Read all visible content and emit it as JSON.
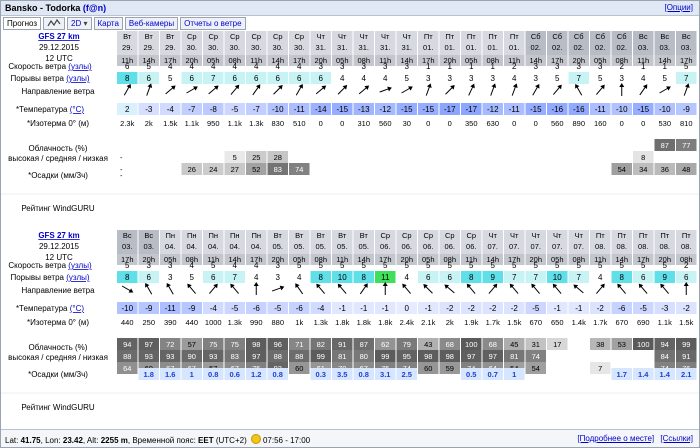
{
  "title": "Bansko - Todorka",
  "title_fan": "(f@n)",
  "options_link": "[Опции]",
  "tabs": [
    {
      "label": "Прогноз",
      "active": true
    },
    {
      "label": "~",
      "icon": "chart-wave-icon"
    },
    {
      "label": "2D"
    },
    {
      "label": "Карта"
    },
    {
      "label": "Веб-камеры"
    },
    {
      "label": "Отчеты о ветре"
    }
  ],
  "row_labels": {
    "wind": "Скорость ветра",
    "wind_unit": "(узлы)",
    "gust": "Порывы ветра",
    "gust_unit": "(узлы)",
    "dir": "Направление ветра",
    "temp": "*Температура",
    "temp_unit": "(°C)",
    "iso": "*Изотерма 0° (м)",
    "cloud1": "Облачность (%)",
    "cloud2": "высокая / средняя / низкая",
    "precip": "*Осадки (мм/3ч)",
    "rating": "Рейтинг WindGURU"
  },
  "colors": {
    "header_bg": "#d6d9df",
    "weekend_bg": "#b8bcc5",
    "wind_light": "#ffffff",
    "gust_lo": "#ffffff",
    "gust_mid": "#c7f3f5",
    "gust_hi": "#5fe0e8",
    "gust_top": "#3ee05a",
    "temp_pos": "#d9f0ff",
    "temp_neg": "#a9b6ff",
    "cloud_low": "#e6e6e6",
    "cloud_mid": "#a6a6a6",
    "cloud_hi": "#808080",
    "precip_bg": "#d6e6ff",
    "precip_text": "#1f3fd1"
  },
  "blocks": [
    {
      "model": "GFS 27 km",
      "date": "29.12.2015",
      "utc": "12 UTC",
      "days": [
        "Вт",
        "Вт",
        "Вт",
        "Ср",
        "Ср",
        "Ср",
        "Ср",
        "Ср",
        "Ср",
        "Чт",
        "Чт",
        "Чт",
        "Чт",
        "Чт",
        "Пт",
        "Пт",
        "Пт",
        "Пт",
        "Пт",
        "Сб",
        "Сб",
        "Сб",
        "Сб",
        "Сб",
        "Вс",
        "Вс",
        "Вс"
      ],
      "dates": [
        "29.",
        "29.",
        "29.",
        "30.",
        "30.",
        "30.",
        "30.",
        "30.",
        "30.",
        "31.",
        "31.",
        "31.",
        "31.",
        "31.",
        "01.",
        "01.",
        "01.",
        "01.",
        "01.",
        "02.",
        "02.",
        "02.",
        "02.",
        "02.",
        "03.",
        "03.",
        "03."
      ],
      "hours": [
        "11h",
        "14h",
        "17h",
        "20h",
        "05h",
        "08h",
        "11h",
        "14h",
        "17h",
        "20h",
        "05h",
        "08h",
        "11h",
        "14h",
        "17h",
        "20h",
        "05h",
        "08h",
        "11h",
        "14h",
        "17h",
        "20h",
        "05h",
        "08h",
        "11h",
        "14h",
        "17h"
      ],
      "wind": [
        "6",
        "5",
        "4",
        "4",
        "4",
        "4",
        "4",
        "4",
        "4",
        "3",
        "3",
        "3",
        "3",
        "3",
        "1",
        "1",
        "1",
        "1",
        "2",
        "3",
        "3",
        "3",
        "3",
        "2",
        "1",
        "1",
        "5"
      ],
      "gust": [
        "8",
        "6",
        "5",
        "6",
        "7",
        "6",
        "6",
        "6",
        "6",
        "6",
        "4",
        "4",
        "4",
        "5",
        "3",
        "3",
        "3",
        "3",
        "4",
        "3",
        "5",
        "7",
        "5",
        "3",
        "4",
        "5",
        "7"
      ],
      "dir": [
        210,
        200,
        230,
        240,
        230,
        220,
        215,
        225,
        210,
        230,
        225,
        230,
        250,
        240,
        200,
        225,
        205,
        200,
        200,
        210,
        220,
        150,
        220,
        180,
        215,
        240,
        200
      ],
      "temp": [
        "2",
        "-3",
        "-4",
        "-7",
        "-8",
        "-5",
        "-7",
        "-10",
        "-11",
        "-14",
        "-15",
        "-13",
        "-12",
        "-15",
        "-15",
        "-17",
        "-17",
        "-12",
        "-11",
        "-15",
        "-16",
        "-16",
        "-11",
        "-10",
        "-15",
        "-10",
        "-9"
      ],
      "iso": [
        "2.3k",
        "2k",
        "1.5k",
        "1.1k",
        "950",
        "1.1k",
        "1.3k",
        "830",
        "510",
        "0",
        "0",
        "310",
        "560",
        "30",
        "0",
        "0",
        "350",
        "630",
        "0",
        "0",
        "560",
        "890",
        "160",
        "0",
        "0",
        "530",
        "810"
      ],
      "cloud_high": [
        "",
        "",
        "",
        "",
        "",
        "",
        "",
        "",
        "",
        "",
        "",
        "",
        "",
        "",
        "",
        "",
        "",
        "",
        "",
        "",
        "",
        "",
        "",
        "",
        "",
        "87",
        "77"
      ],
      "cloud_mid": [
        "-",
        "",
        "",
        "",
        "",
        "5",
        "25",
        "28",
        "",
        "",
        "",
        "",
        "",
        "",
        "",
        "",
        "",
        "",
        "",
        "",
        "",
        "",
        "",
        "",
        "8",
        "",
        ""
      ],
      "cloud_low": [
        "-",
        "",
        "",
        "26",
        "24",
        "27",
        "52",
        "83",
        "74",
        "",
        "",
        "",
        "",
        "",
        "",
        "",
        "",
        "",
        "",
        "",
        "",
        "",
        "",
        "54",
        "34",
        "36",
        "48"
      ],
      "precip": [
        "-",
        "",
        "",
        "",
        "",
        "",
        "",
        "",
        "",
        "",
        "",
        "",
        "",
        "",
        "",
        "",
        "",
        "",
        "",
        "",
        "",
        "",
        "",
        "",
        "",
        "",
        ""
      ]
    },
    {
      "model": "GFS 27 km",
      "date": "29.12.2015",
      "utc": "12 UTC",
      "days": [
        "Вс",
        "Вс",
        "Пн",
        "Пн",
        "Пн",
        "Пн",
        "Пн",
        "Вт",
        "Вт",
        "Вт",
        "Вт",
        "Вт",
        "Ср",
        "Ср",
        "Ср",
        "Ср",
        "Ср",
        "Чт",
        "Чт",
        "Чт",
        "Чт",
        "Чт",
        "Пт",
        "Пт",
        "Пт",
        "Пт",
        "Пт"
      ],
      "dates": [
        "03.",
        "03.",
        "04.",
        "04.",
        "04.",
        "04.",
        "04.",
        "05.",
        "05.",
        "05.",
        "05.",
        "05.",
        "06.",
        "06.",
        "06.",
        "06.",
        "06.",
        "07.",
        "07.",
        "07.",
        "07.",
        "07.",
        "08.",
        "08.",
        "08.",
        "08.",
        "08."
      ],
      "hours": [
        "17h",
        "20h",
        "05h",
        "08h",
        "11h",
        "14h",
        "17h",
        "20h",
        "05h",
        "08h",
        "11h",
        "14h",
        "17h",
        "20h",
        "05h",
        "08h",
        "11h",
        "14h",
        "17h",
        "20h",
        "05h",
        "08h",
        "11h",
        "14h",
        "17h",
        "20h",
        "08h"
      ],
      "wind": [
        "5",
        "3",
        "3",
        "4",
        "5",
        "4",
        "4",
        "3",
        "5",
        "5",
        "5",
        "5",
        "5",
        "5",
        "5",
        "5",
        "5",
        "5",
        "5",
        "5",
        "5",
        "5",
        "5",
        "5",
        "5",
        "5",
        "2"
      ],
      "gust": [
        "8",
        "6",
        "3",
        "5",
        "6",
        "7",
        "4",
        "3",
        "4",
        "8",
        "10",
        "8",
        "11",
        "4",
        "6",
        "6",
        "8",
        "9",
        "7",
        "7",
        "10",
        "7",
        "4",
        "8",
        "6",
        "9",
        "6"
      ],
      "dir": [
        300,
        150,
        150,
        140,
        220,
        140,
        180,
        250,
        145,
        140,
        140,
        215,
        180,
        140,
        135,
        130,
        140,
        220,
        140,
        140,
        140,
        130,
        220,
        140,
        140,
        140,
        180
      ],
      "temp": [
        "-10",
        "-9",
        "-11",
        "-9",
        "-4",
        "-5",
        "-6",
        "-5",
        "-6",
        "-4",
        "-1",
        "-1",
        "-1",
        "0",
        "-1",
        "-2",
        "-2",
        "-2",
        "-2",
        "-5",
        "-1",
        "-1",
        "-2",
        "-6",
        "-5",
        "-3",
        "-2"
      ],
      "iso": [
        "440",
        "250",
        "390",
        "440",
        "1000",
        "1.3k",
        "990",
        "880",
        "1k",
        "1.3k",
        "1.8k",
        "1.8k",
        "1.8k",
        "2.4k",
        "2.1k",
        "2k",
        "1.9k",
        "1.7k",
        "1.5k",
        "670",
        "650",
        "1.4k",
        "1.7k",
        "670",
        "690",
        "1.1k",
        "1.5k"
      ],
      "cloud_high": [
        "94",
        "97",
        "72",
        "57",
        "75",
        "75",
        "98",
        "96",
        "71",
        "82",
        "91",
        "87",
        "62",
        "79",
        "43",
        "68",
        "100",
        "68",
        "45",
        "31",
        "17",
        "",
        "38",
        "53",
        "100",
        "94",
        "99"
      ],
      "cloud_mid": [
        "88",
        "93",
        "93",
        "90",
        "93",
        "83",
        "97",
        "88",
        "88",
        "99",
        "81",
        "80",
        "99",
        "95",
        "98",
        "98",
        "97",
        "97",
        "81",
        "74",
        "",
        "",
        "",
        "",
        "",
        "84",
        "91"
      ],
      "cloud_low": [
        "64",
        "60",
        "67",
        "67",
        "57",
        "67",
        "75",
        "93",
        "60",
        "61",
        "70",
        "67",
        "75",
        "74",
        "60",
        "59",
        "74",
        "64",
        "54",
        "54",
        "",
        "",
        "7",
        "",
        "",
        "74",
        "76"
      ],
      "precip": [
        "",
        "1.8",
        "1.6",
        "1",
        "0.8",
        "0.6",
        "1.2",
        "0.8",
        "",
        "0.3",
        "3.5",
        "0.8",
        "3.1",
        "2.5",
        "",
        "",
        "0.5",
        "0.7",
        "1",
        "",
        "",
        "",
        "",
        "1.7",
        "1.4",
        "1.4",
        "2.1"
      ]
    }
  ],
  "footer": {
    "lat_label": "Lat:",
    "lat": "41.75",
    "lon_label": "Lon:",
    "lon": "23.42",
    "alt_label": "Alt:",
    "alt": "2255 m",
    "tz_label": "Временной пояс:",
    "tz": "EET",
    "tz_offset": "(UTC+2)",
    "sun_time": "07:56 - 17:00",
    "more_link": "[Подробнее о месте]",
    "links_link": "[Ссылки]"
  }
}
